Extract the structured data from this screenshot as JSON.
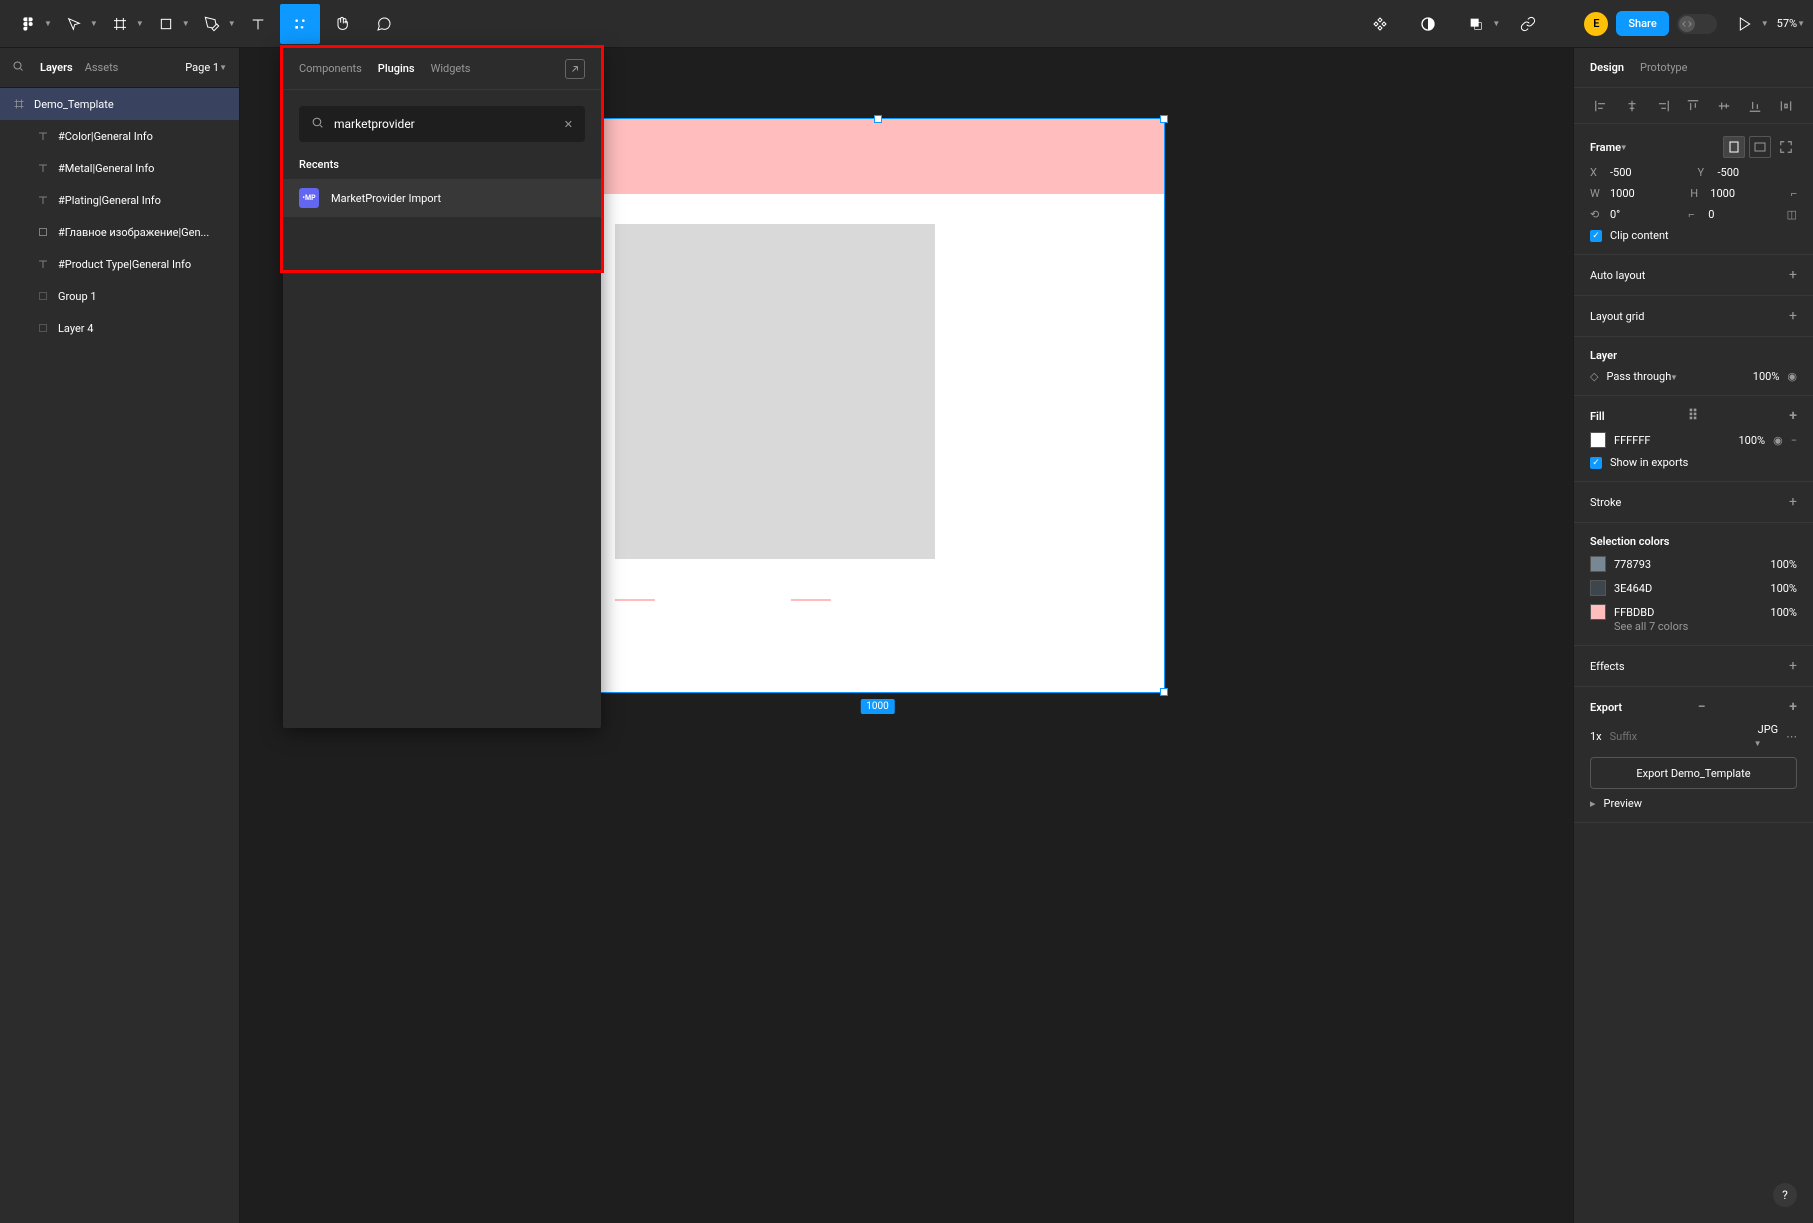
{
  "toolbar": {
    "avatar_letter": "E",
    "share_label": "Share",
    "zoom": "57%"
  },
  "left_panel": {
    "tabs": [
      "Layers",
      "Assets"
    ],
    "active_tab": 0,
    "page_label": "Page 1",
    "layers": [
      {
        "name": "Demo_Template",
        "icon": "frame",
        "selected": true,
        "child": false
      },
      {
        "name": "#Color|General Info",
        "icon": "text",
        "selected": false,
        "child": true
      },
      {
        "name": "#Metal|General Info",
        "icon": "text",
        "selected": false,
        "child": true
      },
      {
        "name": "#Plating|General Info",
        "icon": "text",
        "selected": false,
        "child": true
      },
      {
        "name": "#Главное изображение|Gen...",
        "icon": "rect",
        "selected": false,
        "child": true
      },
      {
        "name": "#Product Type|General Info",
        "icon": "text",
        "selected": false,
        "child": true
      },
      {
        "name": "Group 1",
        "icon": "group",
        "selected": false,
        "child": true
      },
      {
        "name": "Layer 4",
        "icon": "group",
        "selected": false,
        "child": true
      }
    ]
  },
  "plugin_panel": {
    "tabs": [
      "Components",
      "Plugins",
      "Widgets"
    ],
    "active_tab": 1,
    "search_value": "marketprovider",
    "recents_label": "Recents",
    "items": [
      {
        "icon_text": "•MP",
        "name": "MarketProvider Import"
      }
    ]
  },
  "canvas": {
    "dim_label": "1000"
  },
  "right_panel": {
    "tabs": [
      "Design",
      "Prototype"
    ],
    "active_tab": 0,
    "frame": {
      "title": "Frame",
      "x": "-500",
      "y": "-500",
      "w": "1000",
      "h": "1000",
      "rotation": "0°",
      "radius": "0",
      "clip_label": "Clip content"
    },
    "auto_layout_label": "Auto layout",
    "layout_grid_label": "Layout grid",
    "layer": {
      "title": "Layer",
      "blend": "Pass through",
      "opacity": "100%"
    },
    "fill": {
      "title": "Fill",
      "color": "FFFFFF",
      "opacity": "100%",
      "show_exports": "Show in exports"
    },
    "stroke_label": "Stroke",
    "selection_colors": {
      "title": "Selection colors",
      "colors": [
        {
          "hex": "778793",
          "opacity": "100%",
          "swatch": "#778793"
        },
        {
          "hex": "3E464D",
          "opacity": "100%",
          "swatch": "#3E464D"
        },
        {
          "hex": "FFBDBD",
          "opacity": "100%",
          "swatch": "#FFBDBD"
        }
      ],
      "see_all": "See all 7 colors"
    },
    "effects_label": "Effects",
    "export": {
      "title": "Export",
      "scale": "1x",
      "suffix_placeholder": "Suffix",
      "format": "JPG",
      "button": "Export Demo_Template",
      "preview": "Preview"
    }
  }
}
